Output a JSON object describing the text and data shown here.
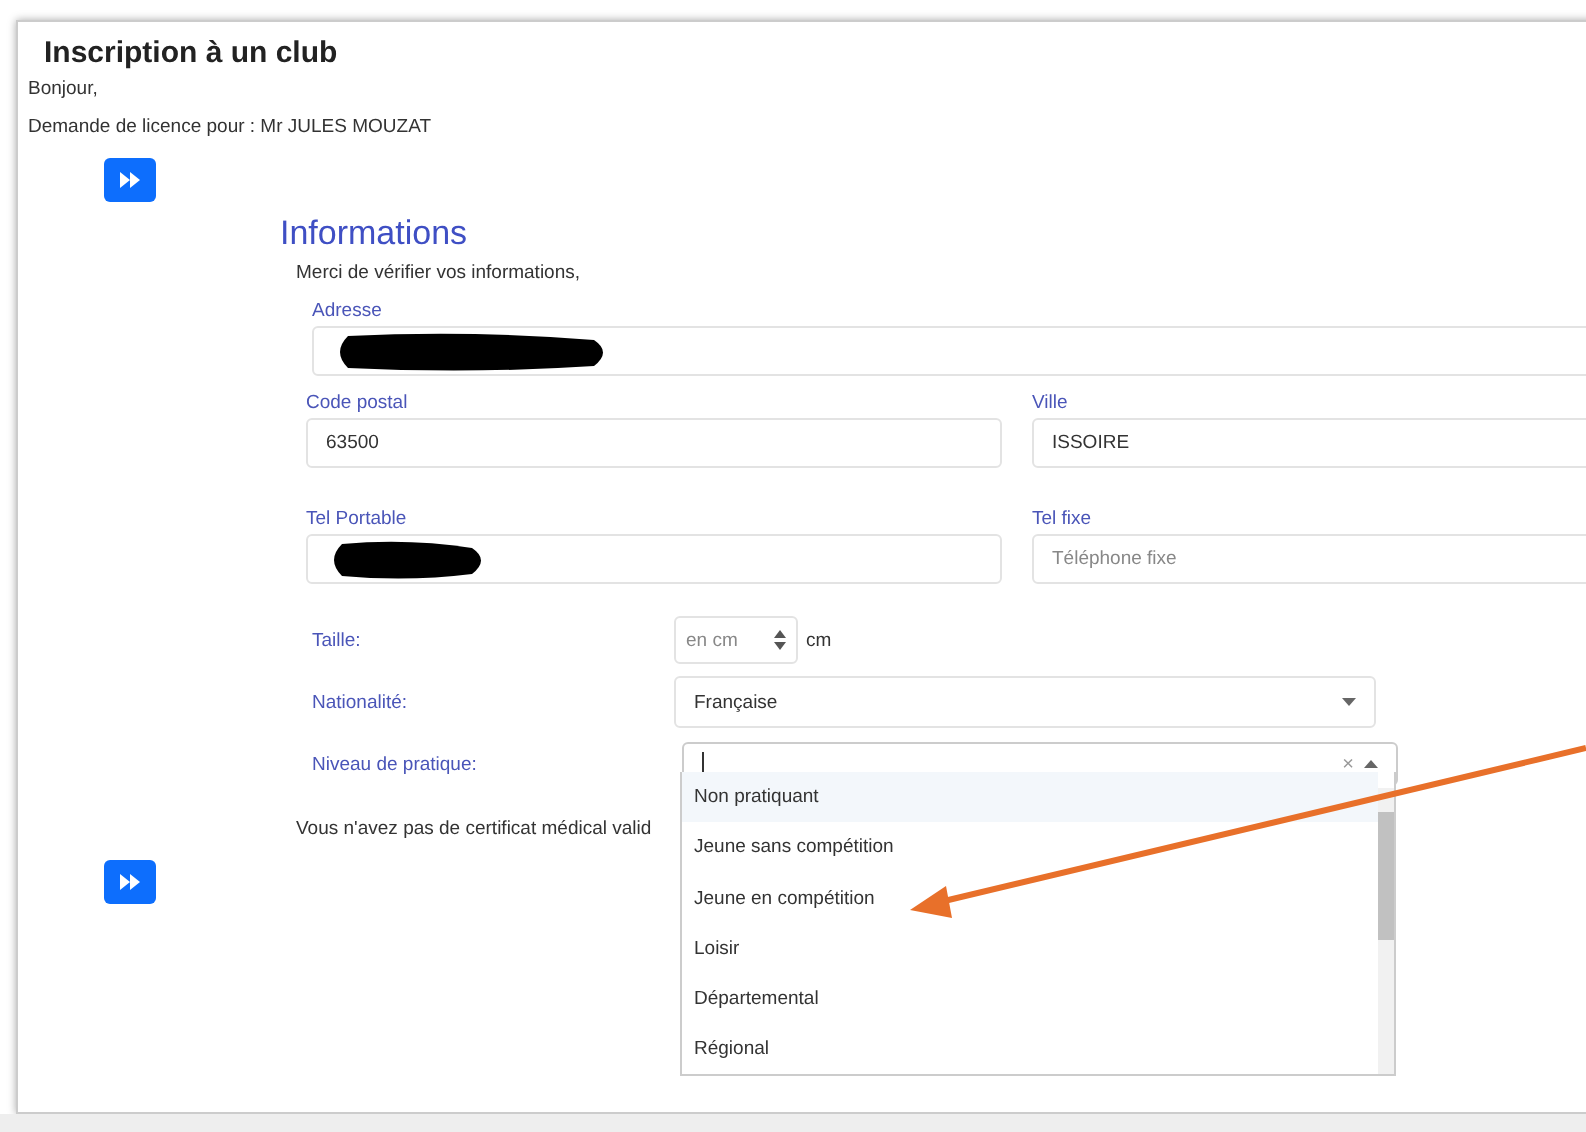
{
  "title": "Inscription à un club",
  "greeting": "Bonjour,",
  "request": "Demande de licence pour : Mr JULES MOUZAT",
  "section": {
    "title": "Informations",
    "intro": "Merci de vérifier vos informations,"
  },
  "address": {
    "label": "Adresse",
    "redacted": true
  },
  "rows": [
    {
      "left": {
        "label": "Code postal",
        "value": "63500"
      },
      "right": {
        "label": "Ville",
        "value": "ISSOIRE"
      }
    },
    {
      "left": {
        "label": "Tel Portable",
        "redacted": true
      },
      "right": {
        "label": "Tel fixe",
        "placeholder": "Téléphone fixe"
      }
    }
  ],
  "height": {
    "label": "Taille:",
    "placeholder": "en cm",
    "unit": "cm"
  },
  "nationality": {
    "label": "Nationalité:",
    "value": "Française"
  },
  "level": {
    "label": "Niveau de pratique:",
    "clear": "×",
    "expanded": true,
    "options": [
      {
        "label": "Non pratiquant",
        "selected": true
      },
      {
        "label": "Jeune sans compétition",
        "selected": false
      },
      {
        "label": "Jeune en compétition",
        "selected": false
      },
      {
        "label": "Loisir",
        "selected": false
      },
      {
        "label": "Départemental",
        "selected": false
      },
      {
        "label": "Régional",
        "selected": false
      }
    ]
  },
  "certificate_note": "Vous n'avez pas de certificat médical valid"
}
